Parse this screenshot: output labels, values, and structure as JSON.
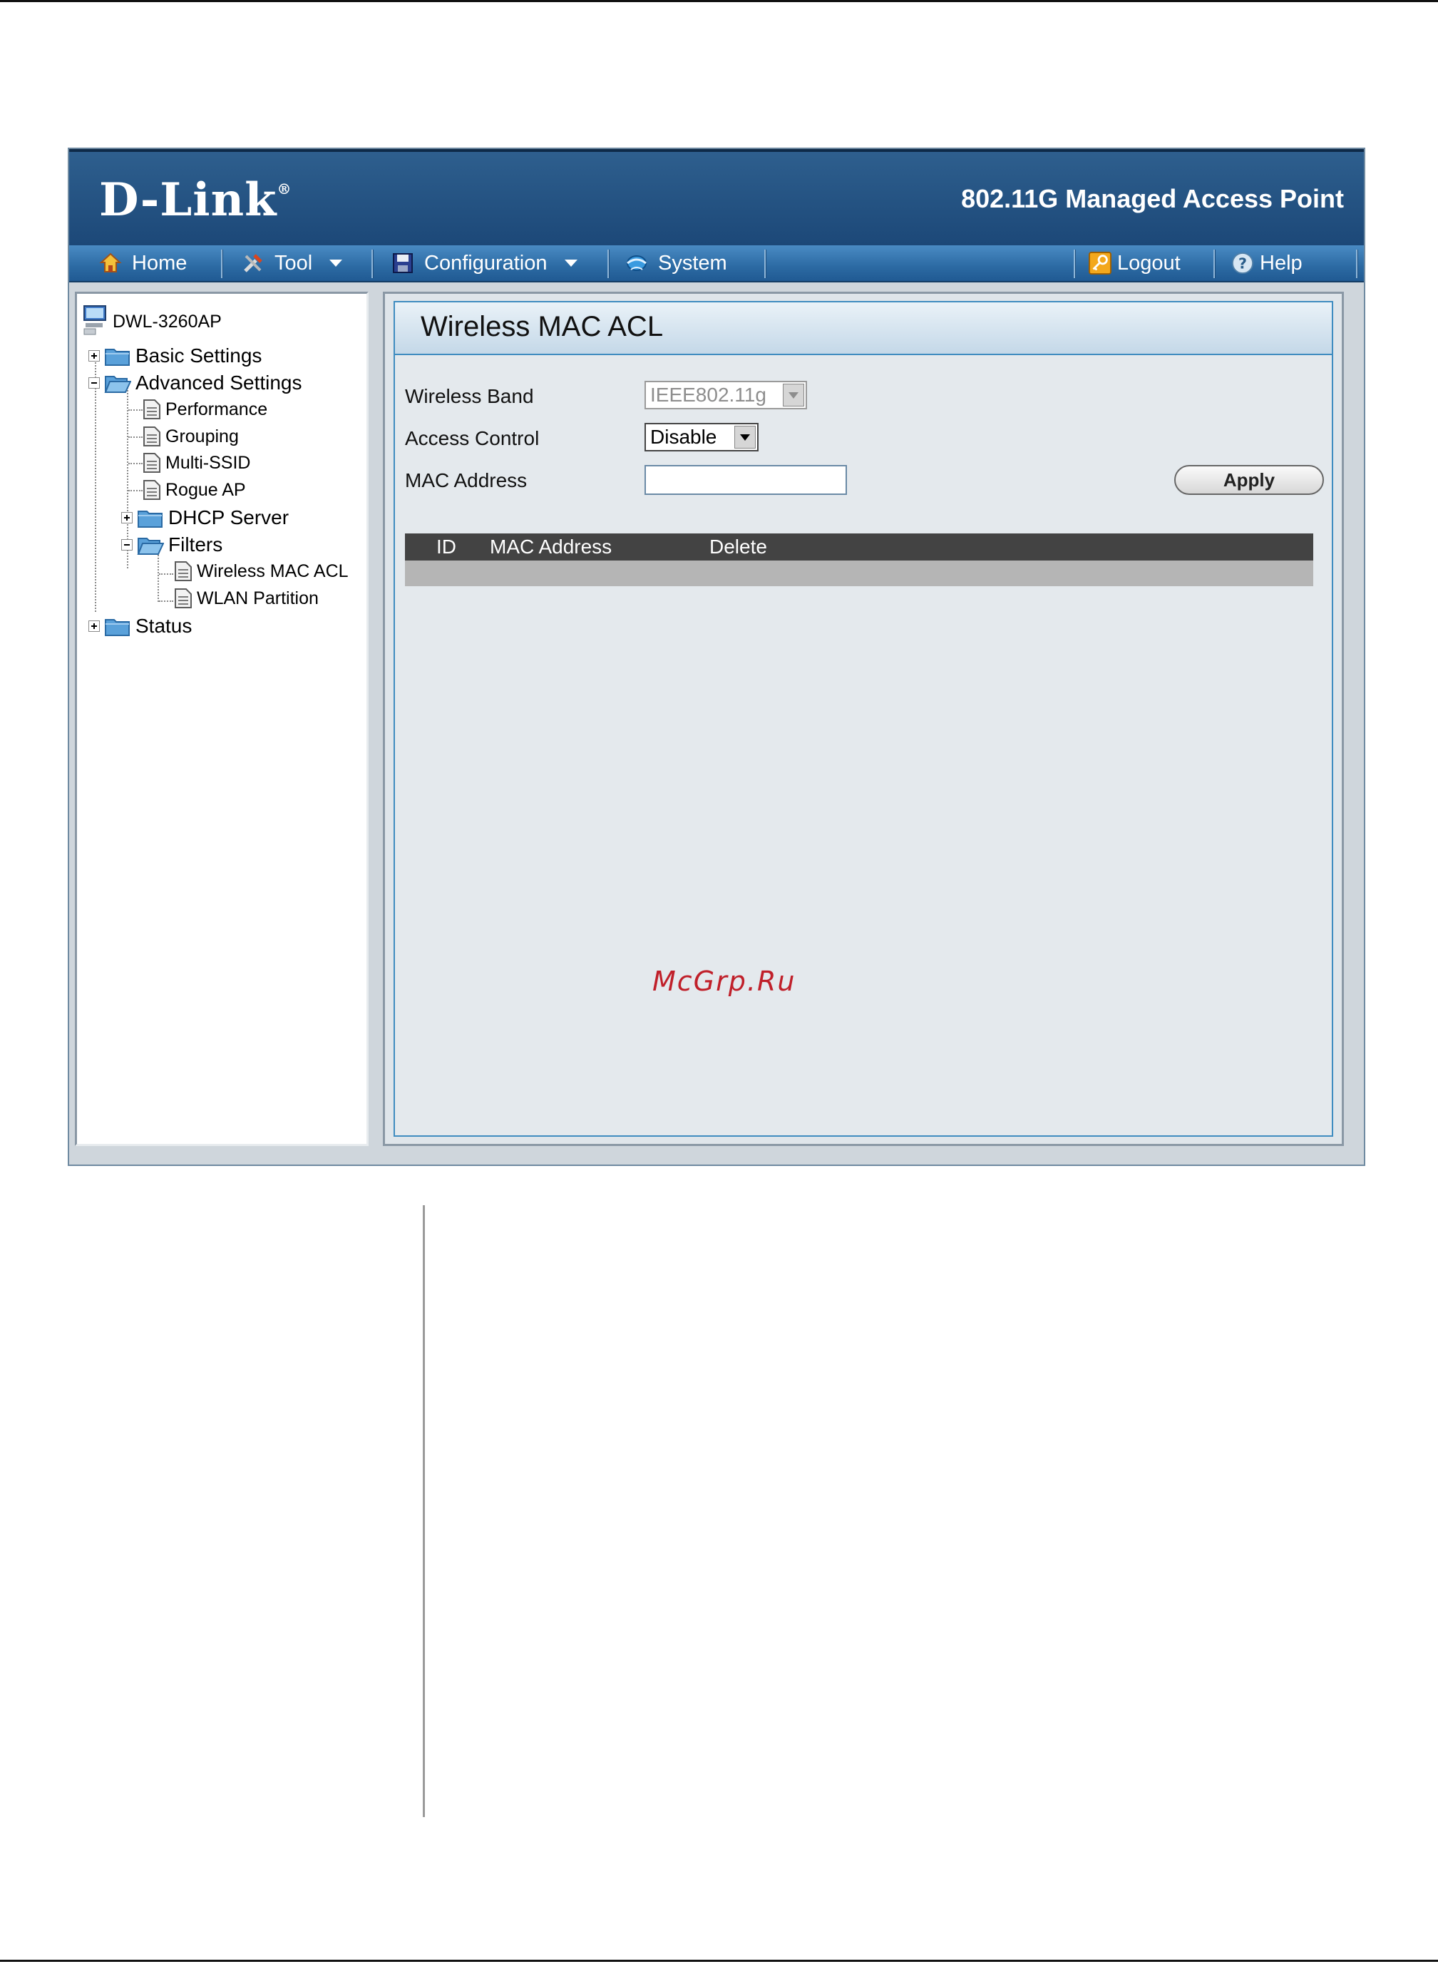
{
  "brand": {
    "logo_text": "D-Link",
    "product_name": "802.11G Managed Access Point"
  },
  "menu": {
    "home": "Home",
    "tool": "Tool",
    "configuration": "Configuration",
    "system": "System",
    "logout": "Logout",
    "help": "Help"
  },
  "tree": {
    "root": "DWL-3260AP",
    "basic_settings": "Basic Settings",
    "advanced_settings": "Advanced Settings",
    "performance": "Performance",
    "grouping": "Grouping",
    "multi_ssid": "Multi-SSID",
    "rogue_ap": "Rogue AP",
    "dhcp_server": "DHCP Server",
    "filters": "Filters",
    "wireless_mac_acl": "Wireless MAC ACL",
    "wlan_partition": "WLAN Partition",
    "status": "Status"
  },
  "page": {
    "title": "Wireless MAC ACL",
    "wireless_band_label": "Wireless Band",
    "wireless_band_value": "IEEE802.11g",
    "access_control_label": "Access Control",
    "access_control_value": "Disable",
    "mac_address_label": "MAC Address",
    "mac_address_value": "",
    "apply_label": "Apply"
  },
  "table": {
    "headers": [
      "ID",
      "MAC Address",
      "Delete"
    ],
    "rows": []
  },
  "watermark": "McGrp.Ru",
  "colors": {
    "header": "#1c4878",
    "menubar": "#2c6aa3",
    "accent": "#3f8cc0",
    "table_head": "#434343",
    "watermark": "#c0202a"
  }
}
